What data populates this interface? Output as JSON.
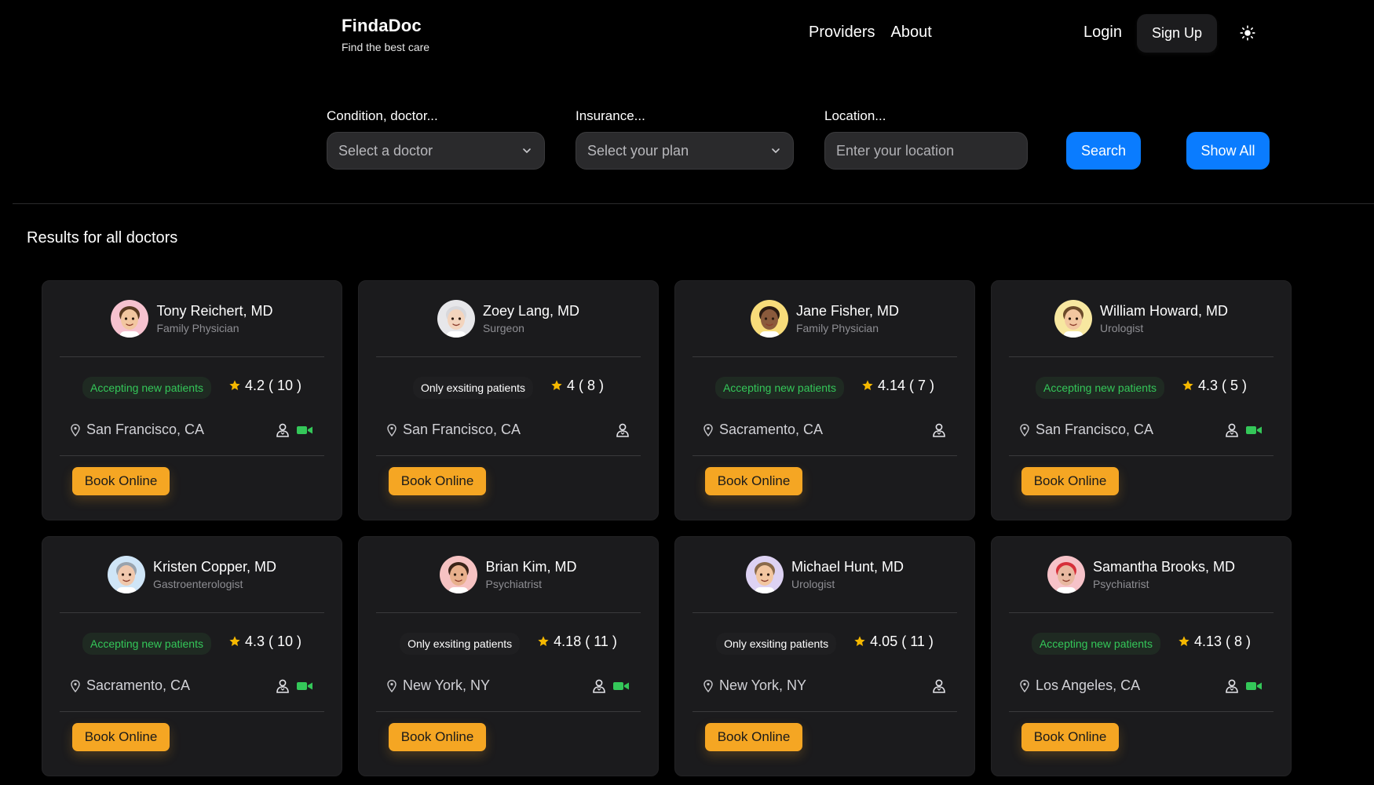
{
  "header": {
    "brand": "FindaDoc",
    "tagline": "Find the best care",
    "nav": [
      "Providers",
      "About"
    ],
    "login": "Login",
    "signup": "Sign Up",
    "theme_icon": "sun-icon"
  },
  "search": {
    "condition_label": "Condition, doctor...",
    "condition_placeholder": "Select a doctor",
    "insurance_label": "Insurance...",
    "insurance_placeholder": "Select your plan",
    "location_label": "Location...",
    "location_placeholder": "Enter your location",
    "search_button": "Search",
    "show_all_button": "Show All"
  },
  "results_heading": "Results for all doctors",
  "book_label": "Book Online",
  "colors": {
    "background": "#000000",
    "card": "#1b1b1d",
    "primary": "#0a7cff",
    "book": "#f5a623",
    "accepting": "#34c759",
    "star": "#f5b800",
    "video": "#34c759"
  },
  "doctors": [
    {
      "name": "Tony Reichert, MD",
      "specialty": "Family Physician",
      "status": "Accepting new patients",
      "accepting": true,
      "rating": "4.2",
      "reviews": "10",
      "location": "San Francisco, CA",
      "in_person": true,
      "video": true,
      "avatar_bg": "#f6c2cf",
      "skin": "#f2c6a0",
      "hair": "#5a3a22"
    },
    {
      "name": "Zoey Lang, MD",
      "specialty": "Surgeon",
      "status": "Only exsiting patients",
      "accepting": false,
      "rating": "4",
      "reviews": "8",
      "location": "San Francisco, CA",
      "in_person": true,
      "video": false,
      "avatar_bg": "#e7e7ea",
      "skin": "#f3d4bd",
      "hair": "#d8d8dc"
    },
    {
      "name": "Jane Fisher, MD",
      "specialty": "Family Physician",
      "status": "Accepting new patients",
      "accepting": true,
      "rating": "4.14",
      "reviews": "7",
      "location": "Sacramento, CA",
      "in_person": true,
      "video": false,
      "avatar_bg": "#f7dc7a",
      "skin": "#8a5a3c",
      "hair": "#2b1b12"
    },
    {
      "name": "William Howard, MD",
      "specialty": "Urologist",
      "status": "Accepting new patients",
      "accepting": true,
      "rating": "4.3",
      "reviews": "5",
      "location": "San Francisco, CA",
      "in_person": true,
      "video": true,
      "avatar_bg": "#f7e7a0",
      "skin": "#f2c6a0",
      "hair": "#6b4a2a"
    },
    {
      "name": "Kristen Copper, MD",
      "specialty": "Gastroenterologist",
      "status": "Accepting new patients",
      "accepting": true,
      "rating": "4.3",
      "reviews": "10",
      "location": "Sacramento, CA",
      "in_person": true,
      "video": true,
      "avatar_bg": "#cfe5f7",
      "skin": "#f0c8ad",
      "hair": "#9aa3ad"
    },
    {
      "name": "Brian Kim, MD",
      "specialty": "Psychiatrist",
      "status": "Only exsiting patients",
      "accepting": false,
      "rating": "4.18",
      "reviews": "11",
      "location": "New York, NY",
      "in_person": true,
      "video": true,
      "avatar_bg": "#f6c2c2",
      "skin": "#e8b08c",
      "hair": "#3a2418"
    },
    {
      "name": "Michael Hunt, MD",
      "specialty": "Urologist",
      "status": "Only exsiting patients",
      "accepting": false,
      "rating": "4.05",
      "reviews": "11",
      "location": "New York, NY",
      "in_person": true,
      "video": false,
      "avatar_bg": "#ddd2f3",
      "skin": "#f2c6a0",
      "hair": "#8a6a4a"
    },
    {
      "name": "Samantha Brooks, MD",
      "specialty": "Psychiatrist",
      "status": "Accepting new patients",
      "accepting": true,
      "rating": "4.13",
      "reviews": "8",
      "location": "Los Angeles, CA",
      "in_person": true,
      "video": true,
      "avatar_bg": "#f6c2c8",
      "skin": "#e8b8a0",
      "hair": "#d6303a"
    }
  ]
}
